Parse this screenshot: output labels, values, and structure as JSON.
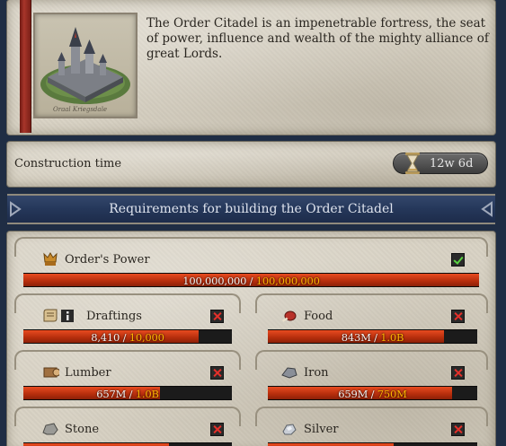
{
  "building": {
    "description": "The Order Citadel is an impenetrable fortress, the seat of power, influence and wealth of the mighty alliance of great Lords."
  },
  "construction": {
    "label": "Construction time",
    "time": "12w 6d",
    "icon": "hourglass-icon"
  },
  "requirements": {
    "title": "Requirements for building the Order Citadel",
    "items": [
      {
        "name": "Order's Power",
        "icon": "crest-icon",
        "met": true,
        "current": "100,000,000",
        "required": "100,000,000",
        "progress": 1.0
      },
      {
        "name": "Draftings",
        "icon": "scroll-icon",
        "met": false,
        "current": "8,410",
        "required": "10,000",
        "progress": 0.841
      },
      {
        "name": "Food",
        "icon": "meat-icon",
        "met": false,
        "current": "843M",
        "required": "1.0B",
        "progress": 0.843
      },
      {
        "name": "Lumber",
        "icon": "lumber-icon",
        "met": false,
        "current": "657M",
        "required": "1.0B",
        "progress": 0.657
      },
      {
        "name": "Iron",
        "icon": "iron-icon",
        "met": false,
        "current": "659M",
        "required": "750M",
        "progress": 0.879
      },
      {
        "name": "Stone",
        "icon": "stone-icon",
        "met": false
      },
      {
        "name": "Silver",
        "icon": "silver-icon",
        "met": false
      }
    ]
  },
  "colors": {
    "background": "#1f2d44",
    "parchment": "#d8d2c4",
    "progress_fill": "#d33e16",
    "required_value": "#ffb400",
    "check": "#5bd342",
    "cross": "#e4302a"
  }
}
